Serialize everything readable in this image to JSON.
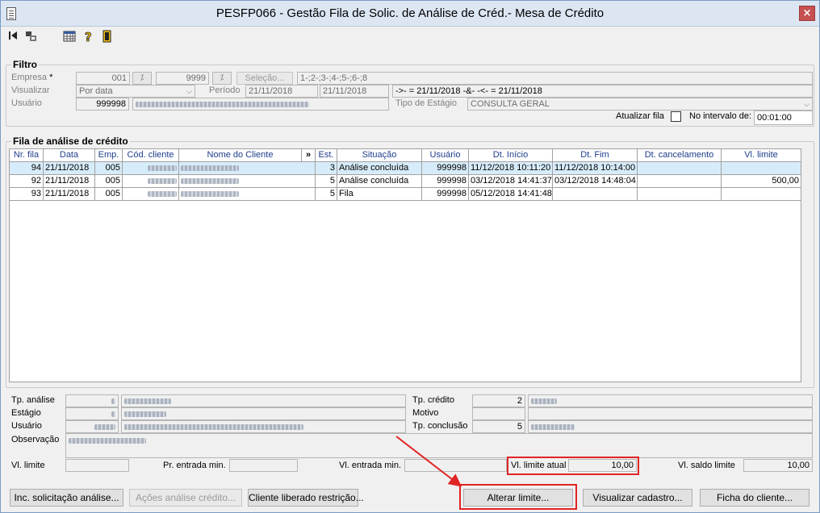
{
  "window": {
    "title": "PESFP066 - Gestão Fila de Solic. de Análise de Créd.- Mesa de Crédito",
    "close": "×"
  },
  "toolbar": {
    "icons": [
      "first-record-icon",
      "records-icon",
      "calendar-grid-icon",
      "help-icon",
      "exit-door-icon"
    ]
  },
  "filter": {
    "title": "Filtro",
    "empresa_label": "Empresa",
    "required_mark": "*",
    "empresa_from": "001",
    "empresa_to": "9999",
    "selecao_label": "Seleção...",
    "selecao_value": "1-;2-;3-;4-;5-;6-;8",
    "visualizar_label": "Visualizar",
    "visualizar_value": "Por data",
    "periodo_label": "Período",
    "periodo_from": "21/11/2018",
    "periodo_to": "21/11/2018",
    "expression": "->- = 21/11/2018 -&- -<- = 21/11/2018",
    "usuario_label": "Usuário",
    "usuario_code": "999998",
    "tipo_estagio_label": "Tipo de Estágio",
    "tipo_estagio_value": "CONSULTA GERAL",
    "atualizar_label": "Atualizar fila",
    "intervalo_label": "No intervalo de:",
    "intervalo_value": "00:01:00"
  },
  "queue": {
    "title": "Fila de análise de crédito",
    "columns": [
      "Nr. fila",
      "Data",
      "Emp.",
      "Cód. cliente",
      "Nome do Cliente",
      "»",
      "Est.",
      "Situação",
      "Usuário",
      "Dt. Início",
      "Dt. Fim",
      "Dt. cancelamento",
      "Vl. limite"
    ],
    "rows": [
      {
        "nr": "94",
        "data": "21/11/2018",
        "emp": "005",
        "est": "3",
        "situacao": "Análise concluída",
        "usuario": "999998",
        "inicio": "11/12/2018 10:11:20",
        "fim": "11/12/2018 10:14:00",
        "cancel": "",
        "limite": ""
      },
      {
        "nr": "92",
        "data": "21/11/2018",
        "emp": "005",
        "est": "5",
        "situacao": "Análise concluída",
        "usuario": "999998",
        "inicio": "03/12/2018 14:41:37",
        "fim": "03/12/2018 14:48:04",
        "cancel": "",
        "limite": "500,00"
      },
      {
        "nr": "93",
        "data": "21/11/2018",
        "emp": "005",
        "est": "5",
        "situacao": "Fila",
        "usuario": "999998",
        "inicio": "05/12/2018 14:41:48",
        "fim": "",
        "cancel": "",
        "limite": ""
      }
    ]
  },
  "details": {
    "tp_analise_label": "Tp. análise",
    "estagio_label": "Estágio",
    "usuario_label": "Usuário",
    "observacao_label": "Observação",
    "tp_credito_label": "Tp. crédito",
    "tp_credito_value": "2",
    "motivo_label": "Motivo",
    "tp_conclusao_label": "Tp. conclusão",
    "tp_conclusao_value": "5",
    "vl_limite_label": "Vl. limite",
    "pr_entrada_label": "Pr. entrada min.",
    "vl_entrada_label": "Vl. entrada min.",
    "vl_limite_atual_label": "Vl. limite atual",
    "vl_limite_atual_value": "10,00",
    "vl_saldo_label": "Vl. saldo limite",
    "vl_saldo_value": "10,00"
  },
  "buttons": {
    "inc": "Inc. solicitação análise...",
    "acoes": "Ações análise crédito...",
    "liberado": "Cliente liberado restrição...",
    "alterar": "Alterar limite...",
    "visualizar": "Visualizar cadastro...",
    "ficha": "Ficha do cliente..."
  },
  "colors": {
    "highlight": "#e02424",
    "selected_row": "#d7ecfa",
    "header_text": "#1f3d8c"
  }
}
